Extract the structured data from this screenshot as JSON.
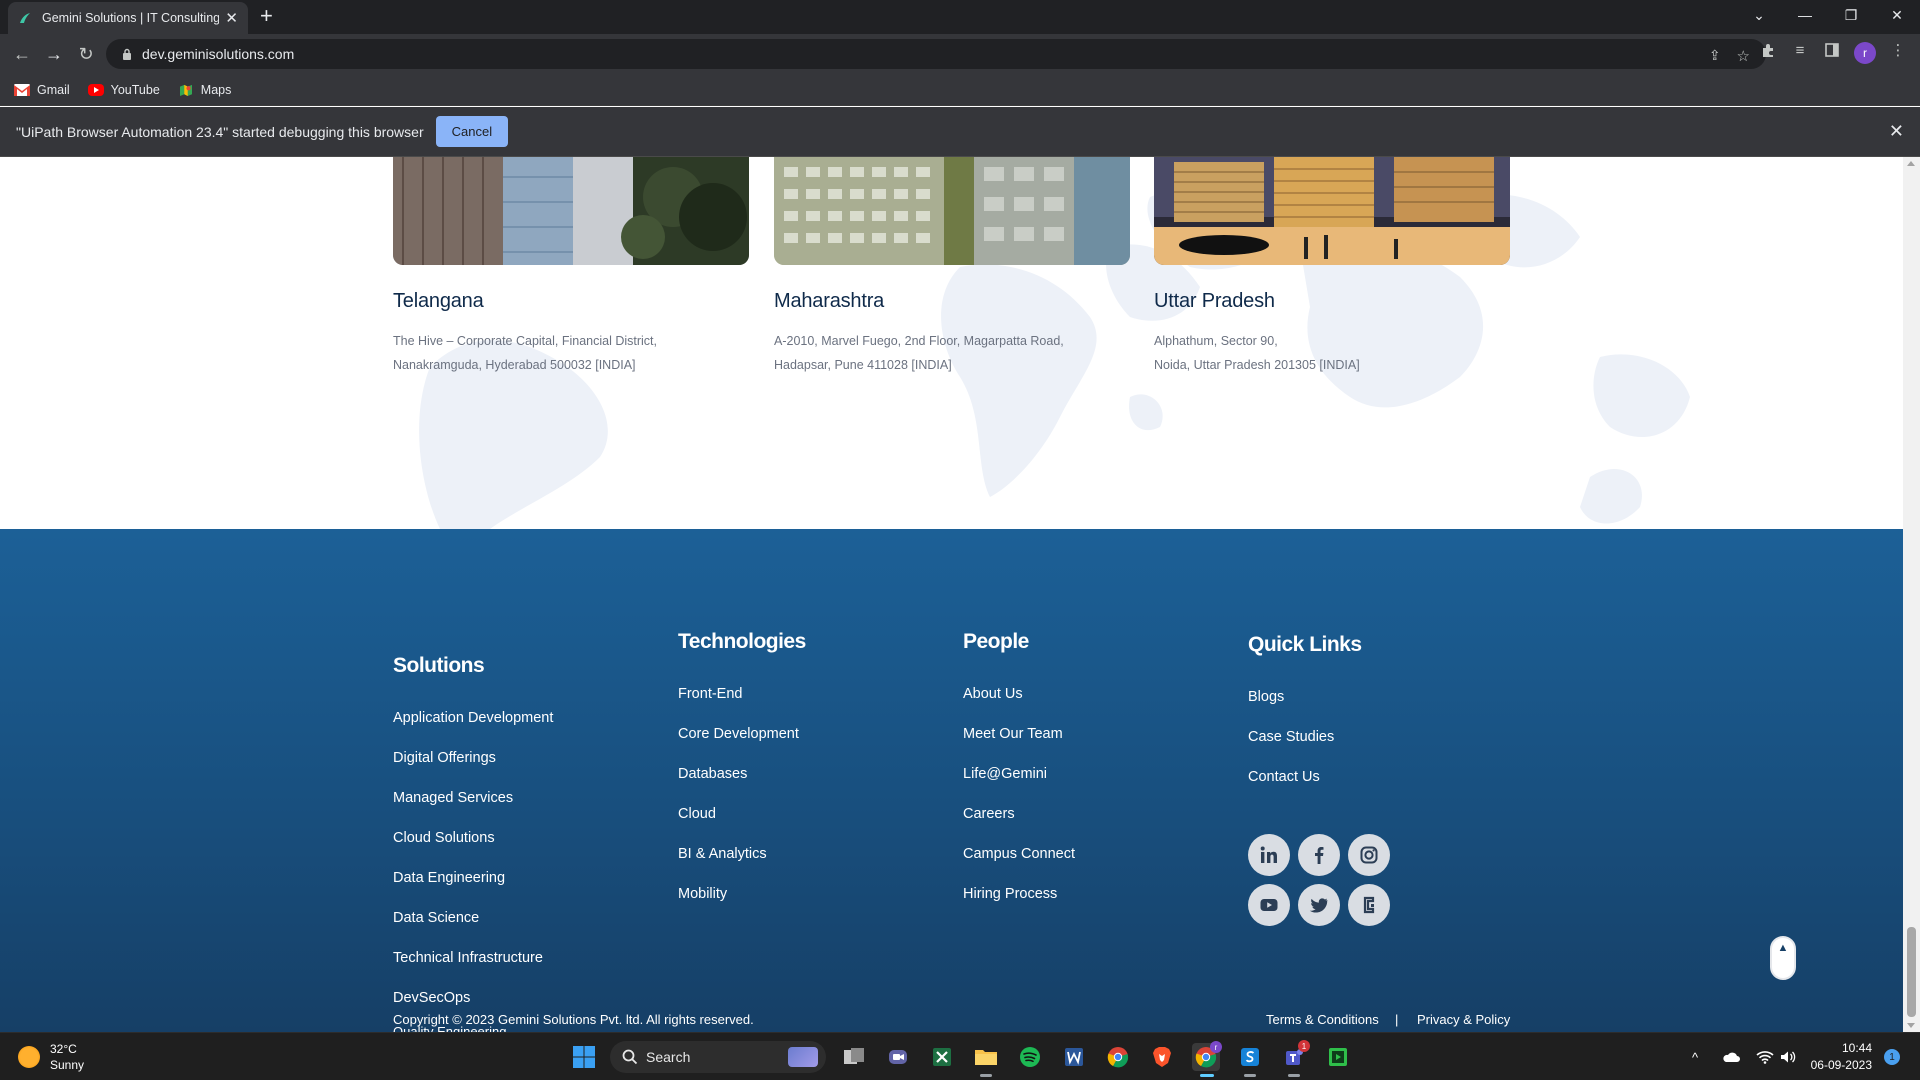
{
  "browser": {
    "tab_title": "Gemini Solutions | IT Consulting,",
    "url": "dev.geminisolutions.com",
    "avatar_letter": "r",
    "bookmarks": [
      {
        "label": "Gmail",
        "icon": "gmail-icon"
      },
      {
        "label": "YouTube",
        "icon": "youtube-icon"
      },
      {
        "label": "Maps",
        "icon": "maps-icon"
      }
    ],
    "infobar": {
      "message": "\"UiPath Browser Automation 23.4\" started debugging this browser",
      "cancel_label": "Cancel"
    }
  },
  "offices": [
    {
      "city": "Telangana",
      "address_line1": "The Hive – Corporate Capital, Financial District,",
      "address_line2": "Nanakramguda, Hyderabad 500032 [INDIA]"
    },
    {
      "city": "Maharashtra",
      "address_line1": "A-2010, Marvel Fuego, 2nd Floor, Magarpatta Road,",
      "address_line2": "Hadapsar, Pune 411028 [INDIA]"
    },
    {
      "city": "Uttar Pradesh",
      "address_line1": "Alphathum, Sector 90,",
      "address_line2": "Noida, Uttar Pradesh 201305 [INDIA]"
    }
  ],
  "footer": {
    "solutions": {
      "heading": "Solutions",
      "links": [
        "Application Development",
        "Digital Offerings",
        "Managed Services",
        "Cloud Solutions",
        "Data Engineering",
        "Data Science",
        "Technical Infrastructure",
        "DevSecOps"
      ]
    },
    "technologies": {
      "heading": "Technologies",
      "links": [
        "Front-End",
        "Core Development",
        "Databases",
        "Cloud",
        "BI & Analytics",
        "Mobility"
      ]
    },
    "people": {
      "heading": "People",
      "links": [
        "About Us",
        "Meet Our Team",
        "Life@Gemini",
        "Careers",
        "Campus Connect",
        "Hiring Process"
      ]
    },
    "quick_links": {
      "heading": "Quick Links",
      "links": [
        "Blogs",
        "Case Studies",
        "Contact Us"
      ]
    },
    "social_icons": [
      "linkedin-icon",
      "facebook-icon",
      "instagram-icon",
      "youtube-icon",
      "twitter-icon",
      "clutch-icon"
    ],
    "copyright": "Copyright © 2023 Gemini Solutions Pvt. ltd. All rights reserved.",
    "clipped_link": "Quality Engineering",
    "terms": "Terms & Conditions",
    "separator": "|",
    "privacy": "Privacy & Policy"
  },
  "taskbar": {
    "weather_temp": "32°C",
    "weather_desc": "Sunny",
    "search_placeholder": "Search",
    "time": "10:44",
    "date": "06-09-2023",
    "notification_count": "1",
    "teams_badge": "1",
    "chrome_badge": "r"
  },
  "colors": {
    "footer_top": "#1c6097",
    "footer_bottom": "#163f66",
    "city_text": "#0f2a4a",
    "address_text": "#6b7280",
    "infobar_button": "#8ab4f8"
  }
}
